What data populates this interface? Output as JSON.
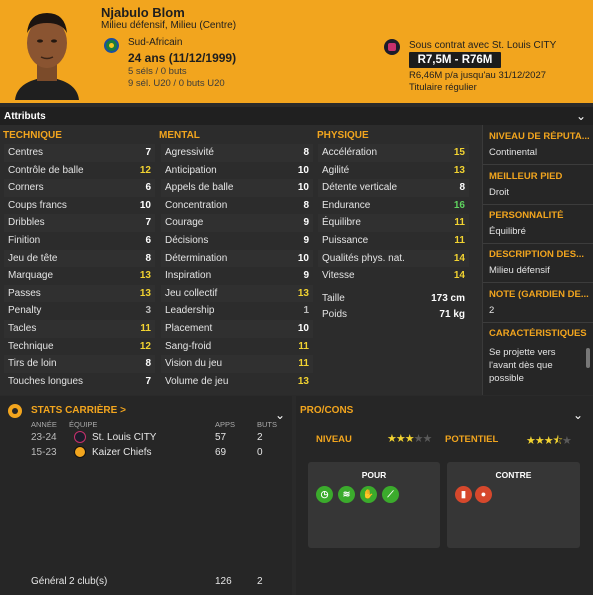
{
  "player": {
    "name": "Njabulo Blom",
    "position": "Milieu défensif, Milieu (Centre)",
    "nationality": "Sud-Africain",
    "age": "24 ans (11/12/1999)",
    "caps": "5 séls / 0 buts",
    "caps_u20": "9 sél. U20 / 0 buts U20",
    "contract": "Sous contrat avec St. Louis CITY",
    "value": "R7,5M - R76M",
    "wage": "R6,46M p/a jusqu'au 31/12/2027",
    "status": "Titulaire régulier"
  },
  "attributes": {
    "title": "Attributs",
    "technique": {
      "label": "TECHNIQUE",
      "rows": [
        {
          "name": "Centres",
          "value": "7",
          "tone": "white"
        },
        {
          "name": "Contrôle de balle",
          "value": "12",
          "tone": "yellow"
        },
        {
          "name": "Corners",
          "value": "6",
          "tone": "white"
        },
        {
          "name": "Coups francs",
          "value": "10",
          "tone": "white"
        },
        {
          "name": "Dribbles",
          "value": "7",
          "tone": "white"
        },
        {
          "name": "Finition",
          "value": "6",
          "tone": "white"
        },
        {
          "name": "Jeu de tête",
          "value": "8",
          "tone": "white"
        },
        {
          "name": "Marquage",
          "value": "13",
          "tone": "yellow"
        },
        {
          "name": "Passes",
          "value": "13",
          "tone": "yellow"
        },
        {
          "name": "Penalty",
          "value": "3",
          "tone": "grey"
        },
        {
          "name": "Tacles",
          "value": "11",
          "tone": "yellow"
        },
        {
          "name": "Technique",
          "value": "12",
          "tone": "yellow"
        },
        {
          "name": "Tirs de loin",
          "value": "8",
          "tone": "white"
        },
        {
          "name": "Touches longues",
          "value": "7",
          "tone": "white"
        }
      ]
    },
    "mental": {
      "label": "MENTAL",
      "rows": [
        {
          "name": "Agressivité",
          "value": "8",
          "tone": "white"
        },
        {
          "name": "Anticipation",
          "value": "10",
          "tone": "white"
        },
        {
          "name": "Appels de balle",
          "value": "10",
          "tone": "white"
        },
        {
          "name": "Concentration",
          "value": "8",
          "tone": "white"
        },
        {
          "name": "Courage",
          "value": "9",
          "tone": "white"
        },
        {
          "name": "Décisions",
          "value": "9",
          "tone": "white"
        },
        {
          "name": "Détermination",
          "value": "10",
          "tone": "white"
        },
        {
          "name": "Inspiration",
          "value": "9",
          "tone": "white"
        },
        {
          "name": "Jeu collectif",
          "value": "13",
          "tone": "yellow"
        },
        {
          "name": "Leadership",
          "value": "1",
          "tone": "grey"
        },
        {
          "name": "Placement",
          "value": "10",
          "tone": "white"
        },
        {
          "name": "Sang-froid",
          "value": "11",
          "tone": "yellow"
        },
        {
          "name": "Vision du jeu",
          "value": "11",
          "tone": "yellow"
        },
        {
          "name": "Volume de jeu",
          "value": "13",
          "tone": "yellow"
        }
      ]
    },
    "physique": {
      "label": "PHYSIQUE",
      "rows": [
        {
          "name": "Accélération",
          "value": "15",
          "tone": "yellow"
        },
        {
          "name": "Agilité",
          "value": "13",
          "tone": "yellow"
        },
        {
          "name": "Détente verticale",
          "value": "8",
          "tone": "white"
        },
        {
          "name": "Endurance",
          "value": "16",
          "tone": "green"
        },
        {
          "name": "Équilibre",
          "value": "11",
          "tone": "yellow"
        },
        {
          "name": "Puissance",
          "value": "11",
          "tone": "yellow"
        },
        {
          "name": "Qualités phys. nat.",
          "value": "14",
          "tone": "yellow"
        },
        {
          "name": "Vitesse",
          "value": "14",
          "tone": "yellow"
        }
      ],
      "height_label": "Taille",
      "height": "173 cm",
      "weight_label": "Poids",
      "weight": "71 kg"
    }
  },
  "info": {
    "reputation_label": "NIVEAU DE RÉPUTA...",
    "reputation": "Continental",
    "foot_label": "MEILLEUR PIED",
    "foot": "Droit",
    "personality_label": "PERSONNALITÉ",
    "personality": "Équilibré",
    "description_label": "DESCRIPTION DES...",
    "description": "Milieu défensif",
    "gk_rating_label": "NOTE (GARDIEN DE...",
    "gk_rating": "2",
    "traits_label": "CARACTÉRISTIQUES J",
    "traits": "Se projette vers l'avant dès que possible"
  },
  "career": {
    "title": "STATS CARRIÈRE >",
    "headers": {
      "year": "ANNÉE",
      "team": "ÉQUIPE",
      "apps": "APPS",
      "goals": "BUTS"
    },
    "rows": [
      {
        "year": "23-24",
        "team": "St. Louis CITY",
        "apps": "57",
        "goals": "2"
      },
      {
        "year": "15-23",
        "team": "Kaizer Chiefs",
        "apps": "69",
        "goals": "0"
      }
    ],
    "total_label": "Général",
    "total_clubs": "2 club(s)",
    "total_apps": "126",
    "total_goals": "2"
  },
  "procons": {
    "title": "PRO/CONS",
    "level_label": "NIVEAU",
    "level_stars": 3,
    "potential_label": "POTENTIEL",
    "potential_stars": 3.5,
    "pour_label": "POUR",
    "contre_label": "CONTRE",
    "pour_icons": [
      "stamina-icon",
      "passing-icon",
      "teamwork-icon",
      "tackling-icon"
    ],
    "contre_icons": [
      "discipline-icon",
      "aerial-icon"
    ]
  }
}
